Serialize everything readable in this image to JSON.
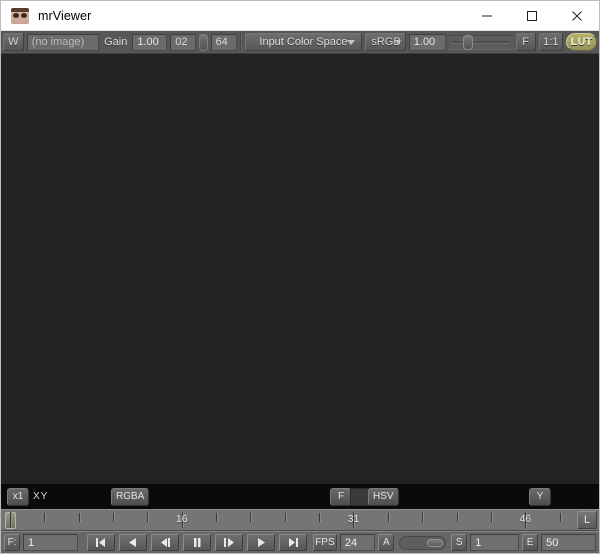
{
  "window": {
    "title": "mrViewer",
    "icon": "app-eyes-icon",
    "minimize_label": "Minimize",
    "maximize_label": "Maximize",
    "close_label": "Close"
  },
  "toolbar": {
    "wipe_button": "W",
    "filename_value": "(no image)",
    "gain_label": "Gain",
    "gain_value": "1.00",
    "clip_low_value": "02",
    "clip_high_value": "64",
    "color_space_label": "Input Color Space",
    "srgb_value": "sRGB",
    "gamma_value": "1.00",
    "fullscreen_button": "F",
    "zoom_button": "1:1",
    "lut_button": "LUT"
  },
  "infobar": {
    "zoom_value": "x1",
    "coords_label": "XY",
    "channels_button": "RGBA",
    "safe_area_button": "F",
    "color_model_button": "HSV",
    "luminance_button": "Y"
  },
  "timeline": {
    "labels": [
      "16",
      "31",
      "46"
    ],
    "label_positions": [
      16,
      31,
      46
    ],
    "playhead_frame": 1,
    "frame_start": 1,
    "frame_end": 50,
    "lock_button": "L"
  },
  "transport": {
    "frame_label": "F:",
    "frame_value": "1",
    "buttons": [
      {
        "name": "first-frame",
        "label": "|<"
      },
      {
        "name": "play-backward",
        "label": "<"
      },
      {
        "name": "step-backward",
        "label": "<|"
      },
      {
        "name": "pause",
        "label": "||"
      },
      {
        "name": "step-forward",
        "label": "|>"
      },
      {
        "name": "play-forward",
        "label": ">"
      },
      {
        "name": "last-frame",
        "label": ">|"
      }
    ],
    "fps_label": "FPS",
    "fps_value": "24",
    "audio_label": "A",
    "start_label": "S",
    "start_value": "1",
    "end_label": "E",
    "end_value": "50"
  },
  "colors": {
    "canvas": "#232323",
    "toolbar": "#575757",
    "infobar": "#0a0a0a",
    "timeline": "#757575",
    "transport": "#676767",
    "lut_accent": "#b4b06a"
  }
}
